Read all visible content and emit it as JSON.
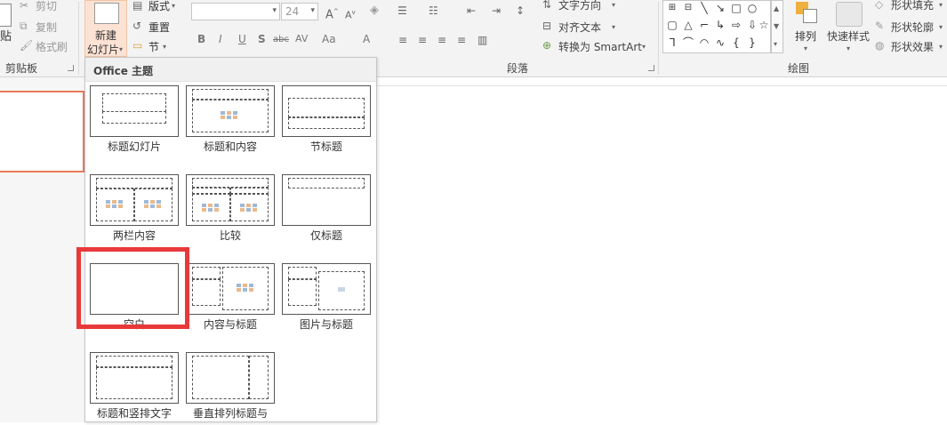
{
  "clipboard": {
    "paste_label": "贴",
    "cut_label": "剪切",
    "copy_label": "复制",
    "format_painter_label": "格式刷",
    "group_label": "剪贴板"
  },
  "slides": {
    "new_slide_line1": "新建",
    "new_slide_line2": "幻灯片",
    "layout_label": "版式",
    "reset_label": "重置",
    "section_label": "节"
  },
  "font": {
    "font_name_value": "",
    "font_size_value": "24",
    "bold": "B",
    "italic": "I",
    "underline": "U",
    "shadow": "S",
    "strike": "abc",
    "spacing": "AV",
    "case": "Aa",
    "color": "A"
  },
  "paragraph": {
    "text_direction_label": "文字方向",
    "align_text_label": "对齐文本",
    "convert_smartart_label": "转换为 SmartArt",
    "group_label": "段落"
  },
  "drawing": {
    "arrange_label": "排列",
    "quick_styles_label": "快速样式",
    "shape_fill_label": "形状填充",
    "shape_outline_label": "形状轮廓",
    "shape_effects_label": "形状效果",
    "group_label": "绘图"
  },
  "gallery": {
    "header": "Office 主题",
    "layouts": [
      {
        "label": "标题幻灯片"
      },
      {
        "label": "标题和内容"
      },
      {
        "label": "节标题"
      },
      {
        "label": "两栏内容"
      },
      {
        "label": "比较"
      },
      {
        "label": "仅标题"
      },
      {
        "label": "空白"
      },
      {
        "label": "内容与标题"
      },
      {
        "label": "图片与标题"
      },
      {
        "label": "标题和竖排文字"
      },
      {
        "label": "垂直排列标题与"
      }
    ]
  },
  "colors": {
    "highlight": "#e8393a",
    "slide_border": "#e97a5a"
  }
}
